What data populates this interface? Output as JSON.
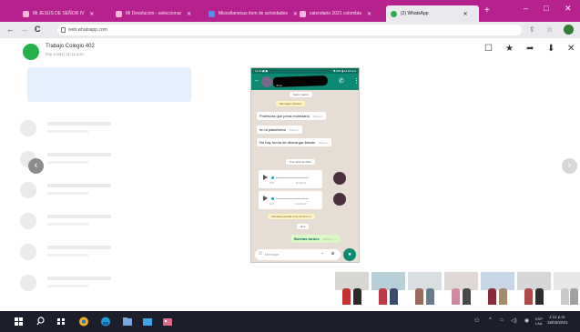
{
  "browser": {
    "tabs": [
      {
        "label": "Mi JESÚS DE SEÑOR IV",
        "favicon_color": "#f2b8d8",
        "active": false
      },
      {
        "label": "Mi Devolución - seleccionar",
        "favicon_color": "#f2b8d8",
        "active": false
      },
      {
        "label": "Miscellaneous item de actividades",
        "favicon_color": "#4f8ff0",
        "active": false
      },
      {
        "label": "calendario 2021 colombia",
        "favicon_color": "#f0b9e0",
        "active": false
      },
      {
        "label": "(2) WhatsApp",
        "favicon_color": "#25b04b",
        "active": true
      }
    ],
    "new_tab_glyph": "+",
    "window_controls": {
      "minimize": "–",
      "maximize": "□",
      "close": "✕"
    },
    "back_glyph": "←",
    "forward_glyph": "→",
    "reload_glyph": "C",
    "url": "web.whatsapp.com",
    "right_icons": [
      "share-icon",
      "star-icon",
      "profile-icon"
    ]
  },
  "viewer": {
    "chat_title": "Trabajo Colegio 402",
    "chat_subtitle": "hoy a la(s) 11:11 a.m.",
    "header_icons": {
      "message": "☐",
      "star": "★",
      "forward": "➦",
      "download": "⬇",
      "close": "✕"
    },
    "nav_prev": "‹",
    "nav_next": "›"
  },
  "phone": {
    "status_time": "11:15 ◼ ◼",
    "status_right": "◥ 33% ▮ 11:15 a.m.",
    "contact_name": "401a",
    "top_chip": "Señor padre",
    "encryption_chip": "Mensajes cifrados",
    "messages": [
      {
        "text": "Profesora que pena molestarla",
        "time": "9:00 a.m.",
        "dir": "in"
      },
      {
        "text": "en la plataforma",
        "time": "9:00 a.m.",
        "dir": "in"
      },
      {
        "text": "No hay forma de descargar listado",
        "time": "9:00 a.m.",
        "dir": "in"
      }
    ],
    "date_chip": "5 de abril de 2021",
    "voice_notes": [
      {
        "length": "0:07",
        "time": "11:10 a.m."
      },
      {
        "length": "0:07",
        "time": "11:10 a.m."
      }
    ],
    "yellow_chip": "Llamada perdida a las 11:32 a.m.",
    "today_chip": "Hoy",
    "out_message": {
      "text": "Buenas tardes",
      "time": "4:50 p.m. ✓✓"
    },
    "input_placeholder": "Mensaje",
    "emoji_glyph": "☺",
    "clip_glyph": "⌁",
    "cam_glyph": "◙",
    "mic_glyph": "●"
  },
  "thumbnails": [
    {
      "sky": "#d8d6d2",
      "fig1": "#c43131",
      "fig2": "#2a2a2a",
      "selected": false
    },
    {
      "sky": "#b8cfd8",
      "fig1": "#c0394a",
      "fig2": "#3a4a6a",
      "selected": false
    },
    {
      "sky": "#d9dfe0",
      "fig1": "#9a6b5a",
      "fig2": "#6a7a8a",
      "selected": false
    },
    {
      "sky": "#e0d8d6",
      "fig1": "#d08aa0",
      "fig2": "#4a4a4a",
      "selected": false
    },
    {
      "sky": "#c6d6e6",
      "fig1": "#8a2a3a",
      "fig2": "#a38a6a",
      "selected": false
    },
    {
      "sky": "#d6d6d6",
      "fig1": "#b04a4a",
      "fig2": "#2e2e2e",
      "selected": false
    },
    {
      "sky": "#e8e8e8",
      "fig1": "#c9c9c9",
      "fig2": "#a0a0a0",
      "selected": false
    }
  ],
  "taskbar": {
    "apps": [
      {
        "name": "start-button",
        "color": "#ffffff"
      },
      {
        "name": "search-icon",
        "color": "#ffffff"
      },
      {
        "name": "task-view-icon",
        "color": "#ffffff"
      },
      {
        "name": "chrome-icon",
        "color": "#f2b01e"
      },
      {
        "name": "edge-icon",
        "color": "#1f9ad6"
      },
      {
        "name": "file-explorer-icon",
        "color": "#7aa8e0"
      },
      {
        "name": "store-icon",
        "color": "#3fa3e8"
      },
      {
        "name": "mail-icon",
        "color": "#1e7fd0"
      },
      {
        "name": "photos-icon",
        "color": "#d86a8a"
      }
    ],
    "tray_text": "ESP LAA",
    "clock_time": "1:11 p.m.",
    "clock_date": "18/03/2021"
  }
}
